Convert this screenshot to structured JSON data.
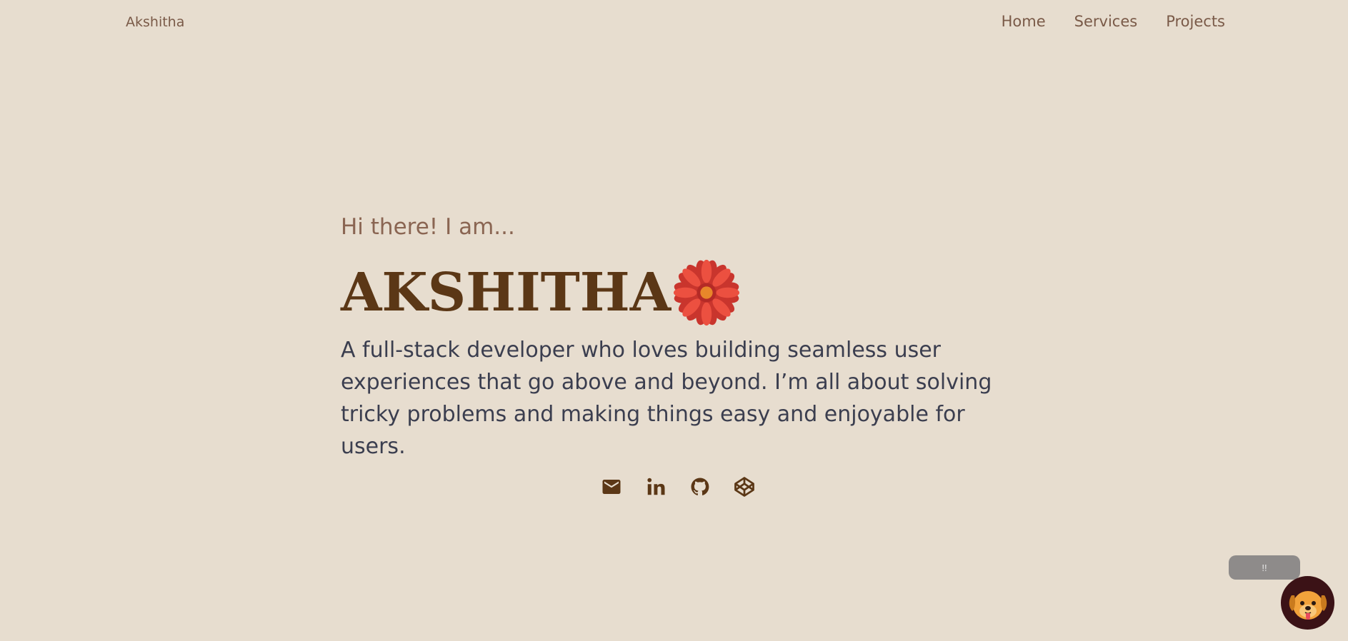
{
  "header": {
    "brand": "Akshitha",
    "nav": [
      {
        "label": "Home"
      },
      {
        "label": "Services"
      },
      {
        "label": "Projects"
      }
    ]
  },
  "hero": {
    "greeting": "Hi there! I am...",
    "name": "AKSHITHA",
    "bio": "A full-stack developer who loves building seamless user experiences that go above and beyond. I’m all about solving tricky problems and making things easy and enjoyable for users."
  },
  "socials": [
    {
      "icon": "mail-icon"
    },
    {
      "icon": "linkedin-icon"
    },
    {
      "icon": "github-icon"
    },
    {
      "icon": "codepen-icon"
    }
  ],
  "chat": {
    "bubble_text": "!!",
    "avatar_icon": "dog-icon"
  },
  "colors": {
    "background": "#e7ddcf",
    "name": "#5b3716",
    "accent_flower": "#e2473b",
    "body_text": "#3b3e4f"
  }
}
